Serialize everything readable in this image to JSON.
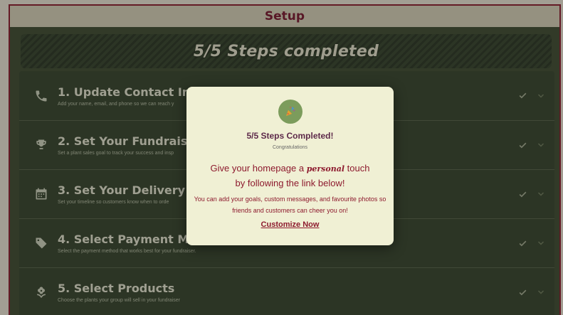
{
  "header": {
    "title": "Setup"
  },
  "progress": {
    "label": "5/5 Steps completed",
    "completed": 5,
    "total": 5
  },
  "steps": [
    {
      "title": "1. Update Contact Info",
      "desc": "Add your name, email, and phone so we can reach y",
      "icon": "phone-icon"
    },
    {
      "title": "2. Set Your Fundraising G",
      "desc": "Set a plant sales goal to track your success and insp",
      "icon": "trophy-icon"
    },
    {
      "title": "3. Set Your Delivery and C",
      "desc": "Set your timeline so customers know when to orde",
      "icon": "calendar-icon"
    },
    {
      "title": "4. Select Payment Metho",
      "desc": "Select the payment method that works best for your fundraiser.",
      "icon": "tag-icon"
    },
    {
      "title": "5. Select Products",
      "desc": "Choose the plants your group will sell in your fundraiser",
      "icon": "plant-icon"
    }
  ],
  "modal": {
    "icon": "party-popper-icon",
    "title": "5/5 Steps Completed!",
    "subtitle": "Congratulations",
    "lead_before": "Give your homepage a ",
    "lead_script": "personal",
    "lead_after": " touch by following the link below!",
    "body": "You can add your goals, custom messages, and favourite photos so friends and customers can cheer you on!",
    "link": "Customize Now"
  },
  "colors": {
    "accent": "#8d1a2e",
    "panel": "#37432f",
    "modal_bg": "#f0f0d4"
  }
}
